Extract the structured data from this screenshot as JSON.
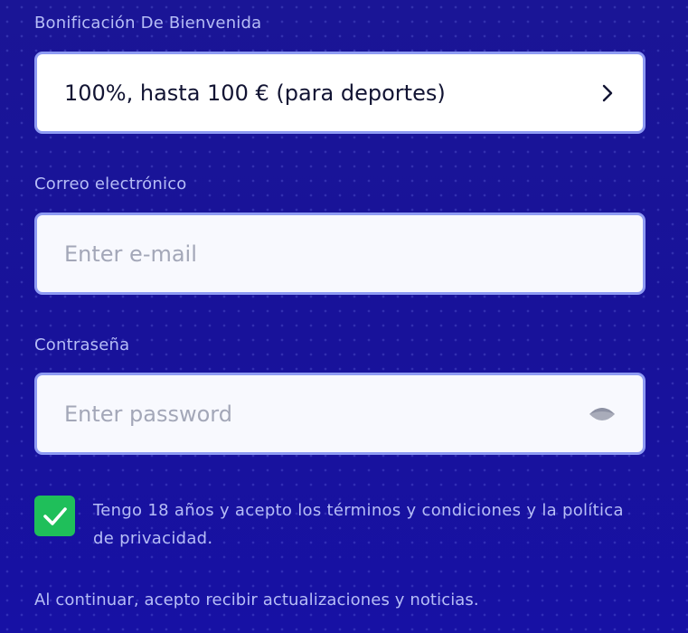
{
  "bonus": {
    "label": "Bonificación De Bienvenida",
    "value": "100%, hasta 100 € (para deportes)",
    "icon": "chevron-right-icon"
  },
  "email": {
    "label": "Correo electrónico",
    "placeholder": "Enter e-mail",
    "value": ""
  },
  "password": {
    "label": "Contraseña",
    "placeholder": "Enter password",
    "value": "",
    "toggle_icon": "eye-icon"
  },
  "terms": {
    "checked": true,
    "text": "Tengo 18 años y acepto los términos y condiciones y la política de privacidad."
  },
  "notice": "Al continuar, acepto recibir actualizaciones y noticias.",
  "colors": {
    "background": "#1a1494",
    "label_text": "#b6bdf6",
    "field_border": "#8e9bf3",
    "checkbox": "#1fbf5a"
  }
}
